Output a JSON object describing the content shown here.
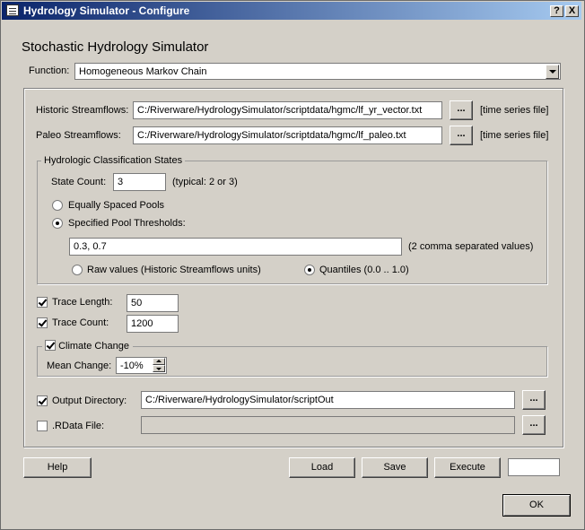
{
  "window": {
    "title": "Hydrology Simulator - Configure",
    "help_glyph": "?",
    "close_glyph": "X"
  },
  "heading": "Stochastic Hydrology Simulator",
  "function": {
    "label": "Function:",
    "value": "Homogeneous Markov Chain"
  },
  "historic": {
    "label": "Historic Streamflows:",
    "value": "C:/Riverware/HydrologySimulator/scriptdata/hgmc/lf_yr_vector.txt",
    "browse_label": "...",
    "note": "[time series file]"
  },
  "paleo": {
    "label": "Paleo Streamflows:",
    "value": "C:/Riverware/HydrologySimulator/scriptdata/hgmc/lf_paleo.txt",
    "browse_label": "...",
    "note": "[time series file]"
  },
  "classification": {
    "group_title": "Hydrologic Classification States",
    "state_count_label": "State Count:",
    "state_count_value": "3",
    "state_count_hint": "(typical: 2 or 3)",
    "equal_pools_label": "Equally Spaced Pools",
    "equal_pools_selected": false,
    "specified_label": "Specified Pool Thresholds:",
    "specified_selected": true,
    "thresholds_value": "0.3, 0.7",
    "thresholds_hint": "(2 comma separated values)",
    "raw_values_label": "Raw values (Historic Streamflows units)",
    "raw_values_selected": false,
    "quantiles_label": "Quantiles (0.0 .. 1.0)",
    "quantiles_selected": true
  },
  "trace_length": {
    "label": "Trace Length:",
    "value": "50",
    "checked": true
  },
  "trace_count": {
    "label": "Trace Count:",
    "value": "1200",
    "checked": true
  },
  "climate_change": {
    "label": "Climate Change",
    "checked": true,
    "mean_change_label": "Mean Change:",
    "mean_change_value": "-10%"
  },
  "output_directory": {
    "label": "Output Directory:",
    "value": "C:/Riverware/HydrologySimulator/scriptOut",
    "checked": true,
    "browse_label": "..."
  },
  "rdata_file": {
    "label": ".RData File:",
    "value": "",
    "checked": false,
    "browse_label": "..."
  },
  "buttons": {
    "help": "Help",
    "load": "Load",
    "save": "Save",
    "execute": "Execute",
    "ok": "OK"
  },
  "status_box_value": ""
}
